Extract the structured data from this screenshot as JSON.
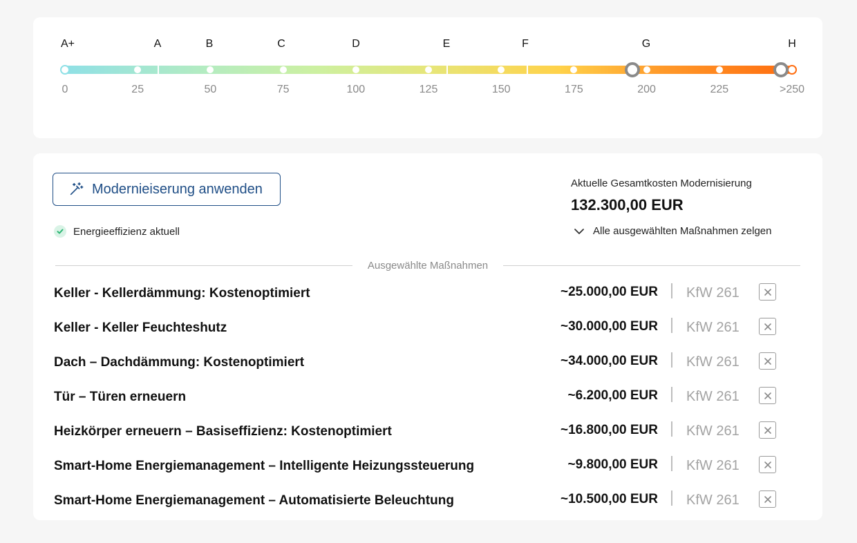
{
  "energy_scale": {
    "classes": [
      "A+",
      "A",
      "B",
      "C",
      "D",
      "E",
      "F",
      "G",
      "H"
    ],
    "ticks": [
      "0",
      "25",
      "50",
      "75",
      "100",
      "125",
      "150",
      "175",
      "200",
      "225",
      ">250"
    ],
    "current_value": 195,
    "target_value": 250
  },
  "actions": {
    "apply_label": "Modernieiserung anwenden",
    "apply_icon": "magic-wand-icon",
    "status_label": "Energieeffizienz aktuell"
  },
  "summary": {
    "total_label": "Aktuelle Gesamtkosten Modernisierung",
    "total_value": "132.300,00 EUR",
    "show_all_label": "Alle ausgewählten Maßnahmen zelgen"
  },
  "divider_label": "Ausgewählte Maßnahmen",
  "measures": [
    {
      "name": "Keller - Kellerdämmung: Kostenoptimiert",
      "cost": "~25.000,00 EUR",
      "funding": "KfW 261"
    },
    {
      "name": "Keller - Keller Feuchteshutz",
      "cost": "~30.000,00 EUR",
      "funding": "KfW 261"
    },
    {
      "name": "Dach – Dachdämmung: Kostenoptimiert",
      "cost": "~34.000,00 EUR",
      "funding": "KfW 261"
    },
    {
      "name": "Tür – Türen erneuern",
      "cost": "~6.200,00 EUR",
      "funding": "KfW 261"
    },
    {
      "name": "Heizkörper erneuern – Basiseffizienz: Kostenoptimiert",
      "cost": "~16.800,00 EUR",
      "funding": "KfW 261"
    },
    {
      "name": "Smart-Home Energiemanagement – Intelligente Heizungssteuerung",
      "cost": "~9.800,00 EUR",
      "funding": "KfW 261"
    },
    {
      "name": "Smart-Home Energiemanagement – Automatisierte Beleuchtung",
      "cost": "~10.500,00 EUR",
      "funding": "KfW 261"
    }
  ],
  "colors": {
    "accent": "#1f4e86",
    "check": "#2bb673",
    "handle": "#8a8a8a"
  }
}
